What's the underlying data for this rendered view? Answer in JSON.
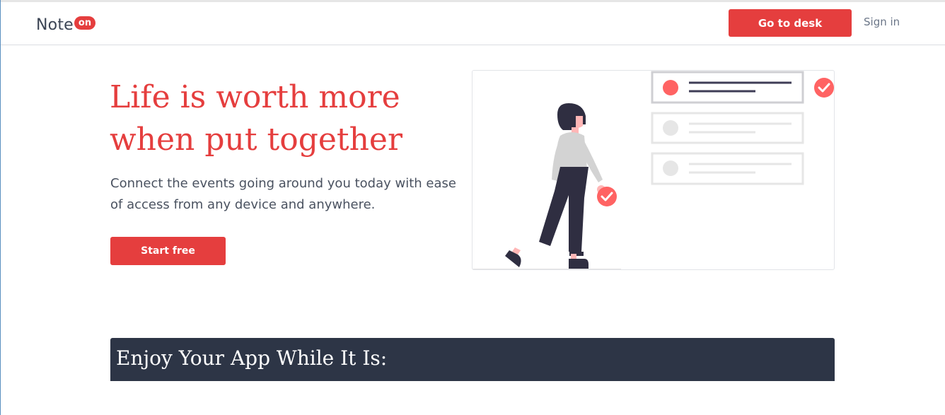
{
  "navbar": {
    "brand_name": "Note",
    "brand_badge": "on",
    "go_to_desk_label": "Go to desk",
    "sign_in_label": "Sign in"
  },
  "hero": {
    "title_line1": "Life is worth more",
    "title_line2": "when put together",
    "subtitle": "Connect the events going around you today with ease of access from any device and anywhere.",
    "cta_label": "Start free"
  },
  "section": {
    "banner_title": "Enjoy Your App While It Is:"
  },
  "colors": {
    "accent": "#e53e3e",
    "dark_banner": "#2d3546",
    "text_muted": "#4a5260",
    "illustration_red": "#ff6363",
    "illustration_dark": "#2f2e41"
  },
  "illustration": {
    "subject": "woman-checking-task-list",
    "icons": [
      "check-circle-icon",
      "check-circle-icon"
    ]
  }
}
